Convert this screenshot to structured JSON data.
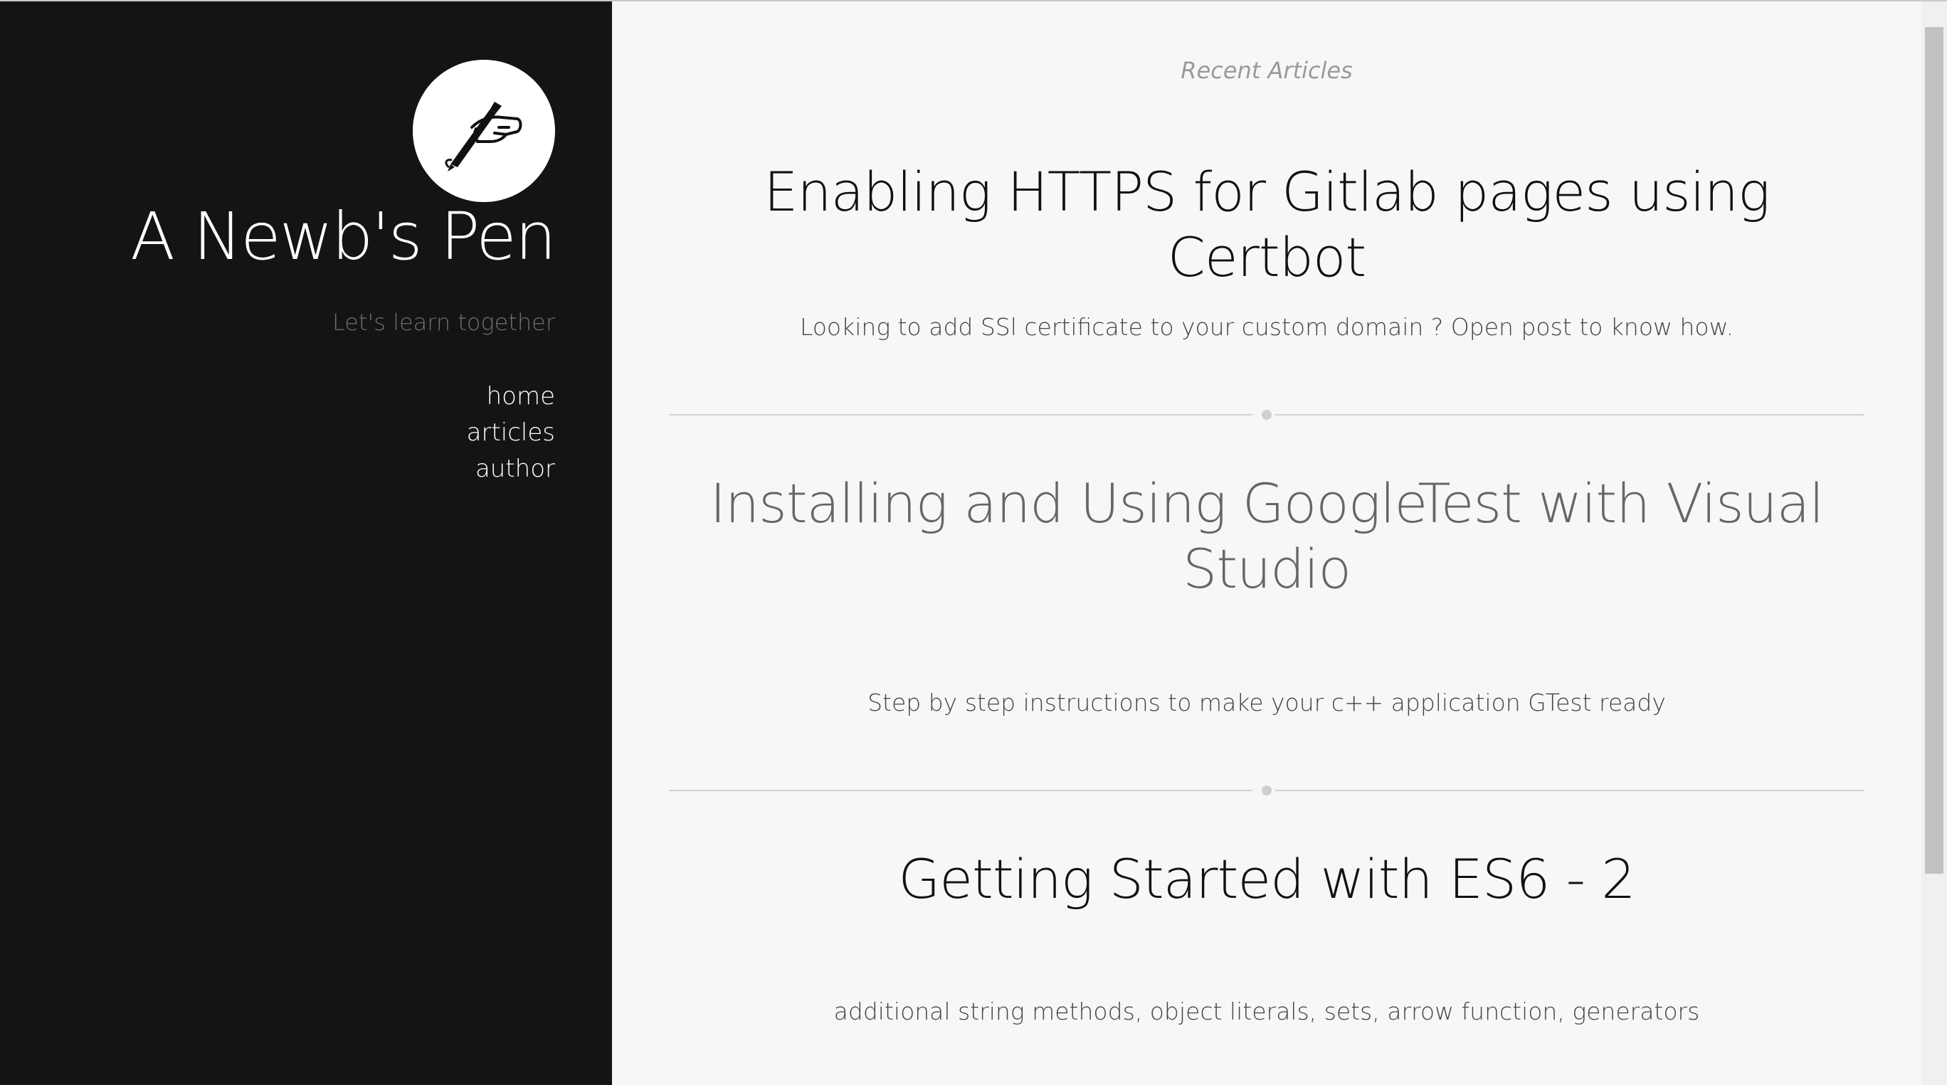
{
  "site": {
    "title": "A Newb's Pen",
    "tagline": "Let's learn together",
    "logo_icon": "pen-hand-icon"
  },
  "nav": {
    "items": [
      {
        "label": "home"
      },
      {
        "label": "articles"
      },
      {
        "label": "author"
      }
    ]
  },
  "main": {
    "section_label": "Recent Articles",
    "articles": [
      {
        "title": "Enabling HTTPS for Gitlab pages using Certbot",
        "description": "Looking to add SSl certificate to your custom domain ? Open post to know how."
      },
      {
        "title": "Installing and Using GoogleTest with Visual Studio",
        "description": "Step by step instructions to make your c++ application GTest ready"
      },
      {
        "title": "Getting Started with ES6 - 2",
        "description": "additional string methods, object literals, sets, arrow function, generators"
      }
    ]
  },
  "colors": {
    "sidebar_bg": "#141414",
    "content_bg": "#f7f7f7",
    "title_dark": "#111111",
    "title_hover_gray": "#666666"
  }
}
